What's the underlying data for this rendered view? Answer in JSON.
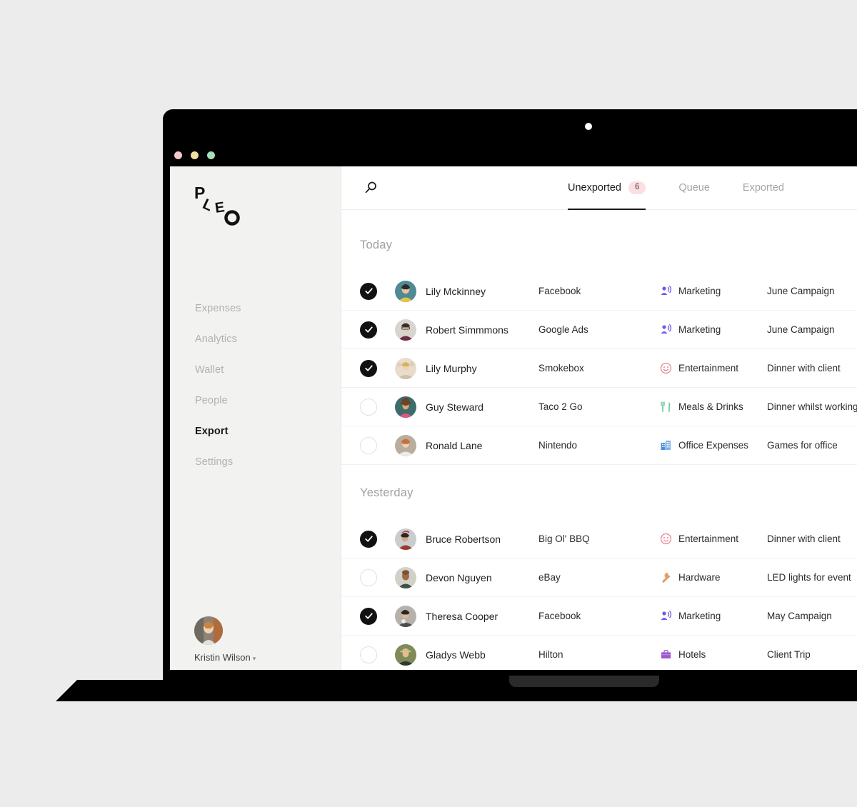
{
  "window": {
    "traffic_lights": [
      "close",
      "minimize",
      "maximize"
    ],
    "camera": "camera-dot"
  },
  "sidebar": {
    "logo_text": "PLEO",
    "items": [
      {
        "label": "Expenses",
        "active": false
      },
      {
        "label": "Analytics",
        "active": false
      },
      {
        "label": "Wallet",
        "active": false
      },
      {
        "label": "People",
        "active": false
      },
      {
        "label": "Export",
        "active": true
      },
      {
        "label": "Settings",
        "active": false
      }
    ],
    "user": {
      "name": "Kristin Wilson",
      "chevron": "▾"
    }
  },
  "topbar": {
    "search_icon": "search-icon",
    "tabs": [
      {
        "label": "Unexported",
        "badge": "6",
        "active": true
      },
      {
        "label": "Queue",
        "badge": "",
        "active": false
      },
      {
        "label": "Exported",
        "badge": "",
        "active": false
      }
    ]
  },
  "groups": [
    {
      "title": "Today",
      "rows": [
        {
          "checked": true,
          "name": "Lily Mckinney",
          "merchant": "Facebook",
          "category": "Marketing",
          "icon": "megaphone-person-icon",
          "description": "June Campaign"
        },
        {
          "checked": true,
          "name": "Robert Simmmons",
          "merchant": "Google Ads",
          "category": "Marketing",
          "icon": "megaphone-person-icon",
          "description": "June Campaign"
        },
        {
          "checked": true,
          "name": "Lily Murphy",
          "merchant": "Smokebox",
          "category": "Entertainment",
          "icon": "smiley-face-icon",
          "description": "Dinner with client"
        },
        {
          "checked": false,
          "name": "Guy Steward",
          "merchant": "Taco 2 Go",
          "category": "Meals & Drinks",
          "icon": "fork-knife-icon",
          "description": "Dinner whilst working"
        },
        {
          "checked": false,
          "name": "Ronald Lane",
          "merchant": "Nintendo",
          "category": "Office Expenses",
          "icon": "office-building-icon",
          "description": "Games for office"
        }
      ]
    },
    {
      "title": "Yesterday",
      "rows": [
        {
          "checked": true,
          "name": "Bruce Robertson",
          "merchant": "Big Ol' BBQ",
          "category": "Entertainment",
          "icon": "smiley-face-icon",
          "description": "Dinner with client"
        },
        {
          "checked": false,
          "name": "Devon Nguyen",
          "merchant": "eBay",
          "category": "Hardware",
          "icon": "wrench-icon",
          "description": "LED lights for event"
        },
        {
          "checked": true,
          "name": "Theresa Cooper",
          "merchant": "Facebook",
          "category": "Marketing",
          "icon": "megaphone-person-icon",
          "description": "May Campaign"
        },
        {
          "checked": false,
          "name": "Gladys Webb",
          "merchant": "Hilton",
          "category": "Hotels",
          "icon": "briefcase-icon",
          "description": "Client Trip"
        }
      ]
    }
  ],
  "colors": {
    "page_background": "#ececec",
    "sidebar_background": "#f2f2f0",
    "device_frame": "#000000",
    "badge_background": "#fbdfe2",
    "active_text": "#1a1a1a",
    "muted_text": "#a5a5a5",
    "icon_marketing": "#6c5ce7",
    "icon_entertainment": "#e87f8f",
    "icon_meals": "#63c892",
    "icon_office": "#4a90d9",
    "icon_hardware": "#e0a06a",
    "icon_hotels": "#9b59d0",
    "traffic_red": "#f6c8cb",
    "traffic_yellow": "#f3de9c",
    "traffic_green": "#a7dfb4"
  }
}
